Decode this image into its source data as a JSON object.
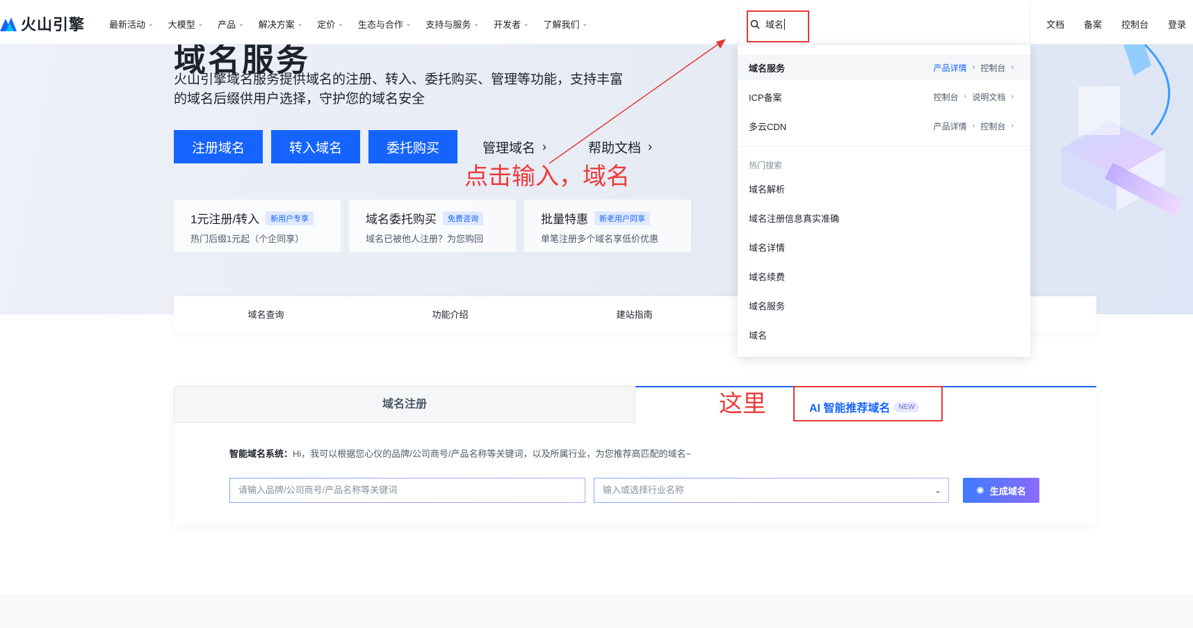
{
  "brand": {
    "name": "火山引擎"
  },
  "nav": {
    "items": [
      "最新活动",
      "大模型",
      "产品",
      "解决方案",
      "定价",
      "生态与合作",
      "支持与服务",
      "开发者",
      "了解我们"
    ],
    "search_value": "域名",
    "right_links": [
      "文档",
      "备案",
      "控制台",
      "登录"
    ]
  },
  "hero": {
    "title": "域名服务",
    "description": "火山引擎域名服务提供域名的注册、转入、委托购买、管理等功能，支持丰富的域名后缀供用户选择，守护您的域名安全",
    "primary_buttons": [
      "注册域名",
      "转入域名",
      "委托购买"
    ],
    "link_buttons": [
      "管理域名",
      "帮助文档"
    ],
    "cards": [
      {
        "title": "1元注册/转入",
        "badge": "新用户专享",
        "subtitle": "热门后缀1元起（个企同享）"
      },
      {
        "title": "域名委托购买",
        "badge": "免费咨询",
        "subtitle": "域名已被他人注册？为您购回"
      },
      {
        "title": "批量特惠",
        "badge": "新老用户同享",
        "subtitle": "单笔注册多个域名享低价优惠"
      }
    ]
  },
  "section_tabs": [
    "域名查询",
    "功能介绍",
    "建站指南"
  ],
  "panel": {
    "tab_register": "域名注册",
    "tab_ai": "AI 智能推荐域名",
    "tab_ai_badge": "NEW",
    "intro_label": "智能域名系统：",
    "intro_text": "Hi，我可以根据您心仪的品牌/公司商号/产品名称等关键词，以及所属行业，为您推荐高匹配的域名~",
    "keyword_placeholder": "请输入品牌/公司商号/产品名称等关键词",
    "industry_placeholder": "输入或选择行业名称",
    "generate_label": "生成域名"
  },
  "dropdown": {
    "results": [
      {
        "label": "域名服务",
        "links": [
          "产品详情",
          "控制台"
        ]
      },
      {
        "label": "ICP备案",
        "links": [
          "控制台",
          "说明文档"
        ]
      },
      {
        "label": "多云CDN",
        "links": [
          "产品详情",
          "控制台"
        ]
      }
    ],
    "hot_title": "热门搜索",
    "hot_items": [
      "域名解析",
      "域名注册信息真实准确",
      "域名详情",
      "域名续费",
      "域名服务",
      "域名"
    ]
  },
  "annotations": {
    "click_input": "点击输入，域名",
    "here": "这里",
    "color": "#e53935"
  },
  "colors": {
    "primary": "#1664ff"
  }
}
